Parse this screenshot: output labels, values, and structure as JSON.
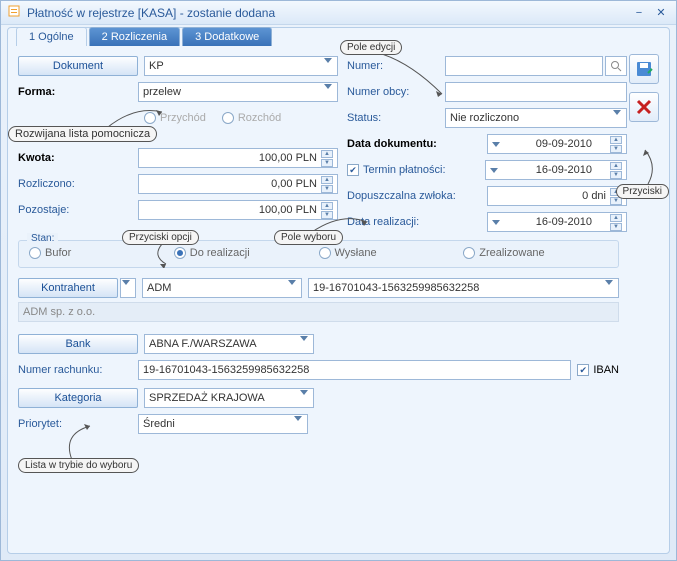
{
  "window": {
    "title": "Płatność w rejestrze [KASA] - zostanie dodana"
  },
  "tabs": {
    "t1": "1 Ogólne",
    "t2": "2 Rozliczenia",
    "t3": "3 Dodatkowe"
  },
  "left": {
    "dokument_btn": "Dokument",
    "dokument_val": "KP",
    "forma_lbl": "Forma:",
    "forma_val": "przelew",
    "przychod": "Przychód",
    "rozchod": "Rozchód",
    "kwota_lbl": "Kwota:",
    "kwota_val": "100,00 PLN",
    "rozliczono_lbl": "Rozliczono:",
    "rozliczono_val": "0,00 PLN",
    "pozostaje_lbl": "Pozostaje:",
    "pozostaje_val": "100,00 PLN"
  },
  "right": {
    "numer_lbl": "Numer:",
    "numer_val": "",
    "numerobcy_lbl": "Numer obcy:",
    "numerobcy_val": "",
    "status_lbl": "Status:",
    "status_val": "Nie rozliczono",
    "datadok_lbl": "Data dokumentu:",
    "datadok_val": "09-09-2010",
    "termin_lbl": "Termin płatności:",
    "termin_val": "16-09-2010",
    "zwloka_lbl": "Dopuszczalna zwłoka:",
    "zwloka_val": "0 dni",
    "datareal_lbl": "Data realizacji:",
    "datareal_val": "16-09-2010"
  },
  "stan": {
    "title": "Stan:",
    "bufor": "Bufor",
    "doreal": "Do realizacji",
    "wyslane": "Wysłane",
    "zreal": "Zrealizowane"
  },
  "kontrahent": {
    "btn": "Kontrahent",
    "code": "ADM",
    "acct": "19-16701043-1563259985632258",
    "name": "ADM sp. z o.o."
  },
  "bank": {
    "btn": "Bank",
    "val": "ABNA F./WARSZAWA",
    "rachunek_lbl": "Numer rachunku:",
    "rachunek_val": "19-16701043-1563259985632258",
    "iban": "IBAN"
  },
  "kategoria": {
    "btn": "Kategoria",
    "val": "SPRZEDAŻ KRAJOWA",
    "priorytet_lbl": "Priorytet:",
    "priorytet_val": "Średni"
  },
  "annot": {
    "pole_edycji": "Pole edycji",
    "rozwijana": "Rozwijana lista pomocnicza",
    "przyciski_opcji": "Przyciski opcji",
    "pole_wyboru": "Pole wyboru",
    "przyciski": "Przyciski",
    "lista_wyboru": "Lista w trybie do wyboru"
  }
}
